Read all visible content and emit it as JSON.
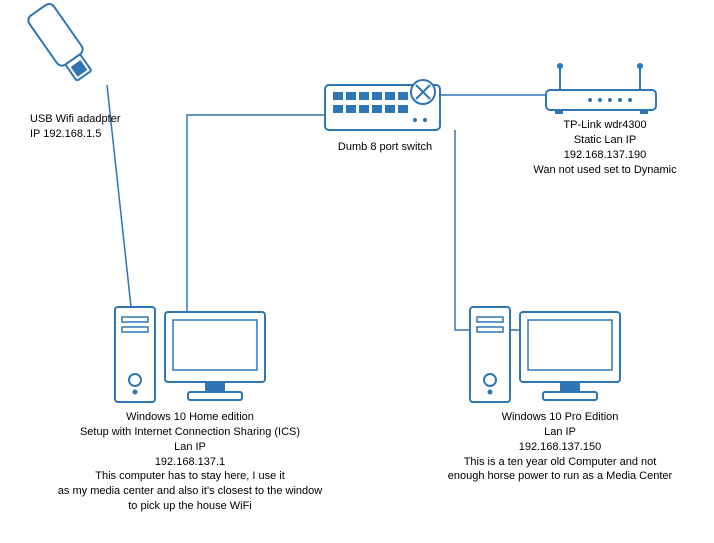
{
  "nodes": {
    "usb_wifi": {
      "label": "USB Wifi adadpter\nIP 192.168.1.5"
    },
    "switch": {
      "label": "Dumb 8 port switch"
    },
    "router": {
      "label": "TP-Link wdr4300\nStatic Lan IP\n192.168.137.190\nWan not used set to Dynamic"
    },
    "pc_left": {
      "label": "Windows 10 Home edition\nSetup with Internet Connection Sharing (ICS)\nLan IP\n192.168.137.1\nThis computer has to stay here, I use it\nas my media center and also it's closest to the window\nto pick up the house WiFi"
    },
    "pc_right": {
      "label": "Windows 10 Pro Edition\nLan IP\n192.168.137.150\nThis is a ten year old Computer and not\nenough horse power to run as a Media Center"
    }
  },
  "connections": [
    {
      "from": "usb_wifi",
      "to": "pc_left"
    },
    {
      "from": "pc_left",
      "to": "switch"
    },
    {
      "from": "switch",
      "to": "router"
    },
    {
      "from": "switch",
      "to": "pc_right"
    }
  ],
  "colors": {
    "line": "#2e75b6"
  }
}
